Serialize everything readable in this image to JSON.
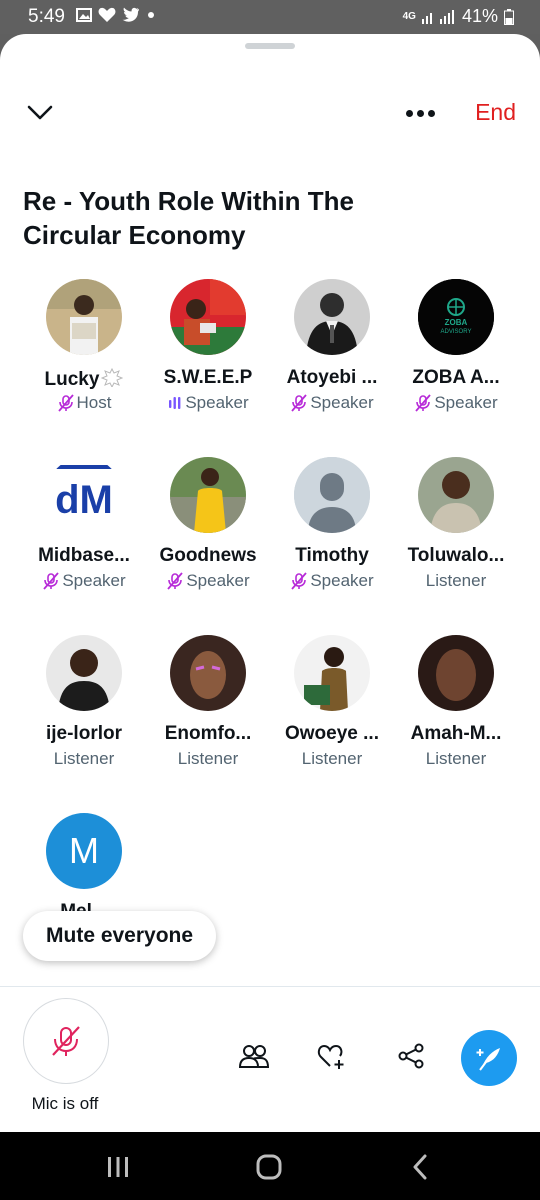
{
  "status": {
    "time": "5:49",
    "network": "4G",
    "battery": "41%",
    "icons": [
      "gallery-icon",
      "heart-icon",
      "twitter-icon",
      "dot-icon"
    ]
  },
  "header": {
    "end_label": "End"
  },
  "space": {
    "title": "Re - Youth Role Within The Circular Economy"
  },
  "participants": [
    {
      "name": "Lucky",
      "role": "Host",
      "role_icon": "mic-off-icon"
    },
    {
      "name": "S.W.E.E.P",
      "role": "Speaker",
      "role_icon": "speaking-icon"
    },
    {
      "name": "Atoyebi ...",
      "role": "Speaker",
      "role_icon": "mic-off-icon"
    },
    {
      "name": "ZOBA A...",
      "role": "Speaker",
      "role_icon": "mic-off-icon"
    },
    {
      "name": "Midbase...",
      "role": "Speaker",
      "role_icon": "mic-off-icon"
    },
    {
      "name": "Goodnews",
      "role": "Speaker",
      "role_icon": "mic-off-icon"
    },
    {
      "name": "Timothy",
      "role": "Speaker",
      "role_icon": "mic-off-icon"
    },
    {
      "name": "Toluwalo...",
      "role": "Listener",
      "role_icon": ""
    },
    {
      "name": "ije-lorlor",
      "role": "Listener",
      "role_icon": ""
    },
    {
      "name": "Enomfo...",
      "role": "Listener",
      "role_icon": ""
    },
    {
      "name": "Owoeye ...",
      "role": "Listener",
      "role_icon": ""
    },
    {
      "name": "Amah-M...",
      "role": "Listener",
      "role_icon": ""
    },
    {
      "name": "Mel...",
      "role": "",
      "role_icon": "",
      "initial": "M"
    }
  ],
  "logo_text": {
    "zoba": "ZOBA",
    "advisory": "ADVISORY",
    "midbase": "dM"
  },
  "toast": {
    "mute_everyone": "Mute everyone"
  },
  "controls": {
    "mic_label": "Mic is off"
  },
  "colors": {
    "accent": "#1d9bf0",
    "end": "#e02020",
    "muted_icon": "#b72bd8",
    "speaking": "#7856ff"
  }
}
